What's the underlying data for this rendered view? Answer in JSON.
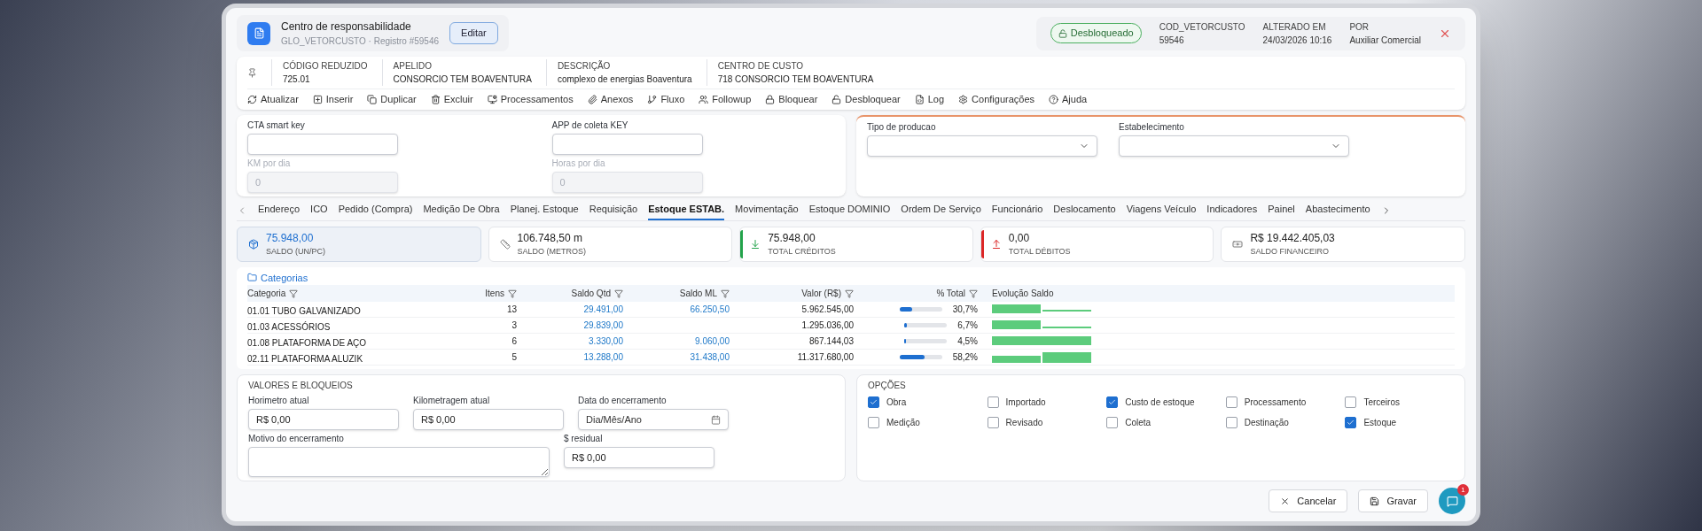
{
  "record": {
    "title": "Centro de responsabilidade",
    "subtitle": "GLO_VETORCUSTO · Registro #59546",
    "edit_button": "Editar"
  },
  "status": {
    "badge": "Desbloqueado",
    "locked": false
  },
  "meta": [
    {
      "label": "COD_VETORCUSTO",
      "value": "59546"
    },
    {
      "label": "ALTERADO EM",
      "value": "24/03/2026 10:16"
    },
    {
      "label": "POR",
      "value": "Auxiliar Comercial"
    }
  ],
  "info": [
    {
      "label": "CÓDIGO REDUZIDO",
      "value": "725.01"
    },
    {
      "label": "APELIDO",
      "value": "CONSORCIO TEM BOAVENTURA"
    },
    {
      "label": "DESCRIÇÃO",
      "value": "complexo de energias Boaventura"
    },
    {
      "label": "CENTRO DE CUSTO",
      "value": "718 CONSORCIO TEM BOAVENTURA"
    }
  ],
  "toolbar": [
    "Atualizar",
    "Inserir",
    "Duplicar",
    "Excluir",
    "Processamentos",
    "Anexos",
    "Fluxo",
    "Followup",
    "Bloquear",
    "Desbloquear",
    "Log",
    "Configurações",
    "Ajuda"
  ],
  "form_left": [
    {
      "kind": "text",
      "label": "CTA smart key",
      "disabled": false
    },
    {
      "kind": "text",
      "label": "APP de coleta KEY",
      "disabled": false
    },
    {
      "kind": "text",
      "label": "KM por dia",
      "value": "0",
      "disabled": true
    },
    {
      "kind": "text",
      "label": "Horas por dia",
      "value": "0",
      "disabled": true
    }
  ],
  "form_right": [
    {
      "kind": "select",
      "label": "Tipo de producao",
      "disabled": false
    },
    {
      "kind": "select",
      "label": "Estabelecimento",
      "disabled": false
    }
  ],
  "tabs": [
    {
      "label": "Endereço",
      "selected": false
    },
    {
      "label": "ICO",
      "selected": false
    },
    {
      "label": "Pedido (Compra)",
      "selected": false
    },
    {
      "label": "Medição De Obra",
      "selected": false
    },
    {
      "label": "Planej. Estoque",
      "selected": false
    },
    {
      "label": "Requisição",
      "selected": false
    },
    {
      "label": "Estoque ESTAB.",
      "selected": true
    },
    {
      "label": "Movimentação",
      "selected": false
    },
    {
      "label": "Estoque DOMINIO",
      "selected": false
    },
    {
      "label": "Ordem De Serviço",
      "selected": false
    },
    {
      "label": "Funcionário",
      "selected": false
    },
    {
      "label": "Deslocamento",
      "selected": false
    },
    {
      "label": "Viagens Veículo",
      "selected": false
    },
    {
      "label": "Indicadores",
      "selected": false
    },
    {
      "label": "Painel",
      "selected": false
    },
    {
      "label": "Abastecimento",
      "selected": false
    }
  ],
  "stats": [
    {
      "value": "75.948,00",
      "label": "SALDO (UN/PC)",
      "selected": true
    },
    {
      "value": "106.748,50 m",
      "label": "SALDO (METROS)",
      "selected": false
    },
    {
      "value": "75.948,00",
      "label": "TOTAL CRÉDITOS",
      "selected": false,
      "color": "#22a34a"
    },
    {
      "value": "0,00",
      "label": "TOTAL DÉBITOS",
      "selected": false,
      "color": "#dc2626"
    },
    {
      "value": "R$ 19.442.405,03",
      "label": "SALDO FINANCEIRO",
      "selected": false
    }
  ],
  "table": {
    "link": "Categorias",
    "columns": [
      {
        "label": "Categoria",
        "filter": true
      },
      {
        "label": "Itens",
        "filter": true
      },
      {
        "label": "Saldo Qtd",
        "filter": true
      },
      {
        "label": "Saldo ML",
        "filter": true
      },
      {
        "label": "Valor (R$)",
        "filter": true
      },
      {
        "label": "% Total",
        "filter": true
      },
      {
        "label": "Evolução Saldo",
        "filter": false
      }
    ],
    "rows": [
      {
        "categoria": "01.01 TUBO GALVANIZADO",
        "itens": "13",
        "saldo_qtd": "29.491,00",
        "saldo_ml": "66.250,50",
        "valor": "5.962.545,00",
        "percent": "30,7%",
        "level": 0.307
      },
      {
        "categoria": "01.03 ACESSÓRIOS",
        "itens": "3",
        "saldo_qtd": "29.839,00",
        "valor": "1.295.036,00",
        "percent": "6,7%",
        "level": 0.067
      },
      {
        "categoria": "01.08 PLATAFORMA DE AÇO",
        "itens": "6",
        "saldo_qtd": "3.330,00",
        "saldo_ml": "9.060,00",
        "valor": "867.144,03",
        "percent": "4,5%",
        "level": 0.045
      },
      {
        "categoria": "02.11 PLATAFORMA ALUZIK",
        "itens": "5",
        "saldo_qtd": "13.288,00",
        "saldo_ml": "31.438,00",
        "valor": "11.317.680,00",
        "percent": "58,2%",
        "level": 0.582
      }
    ]
  },
  "valores": {
    "title": "VALORES E BLOQUEIOS",
    "fields": [
      {
        "kind": "text",
        "label": "Horimetro atual",
        "value": "R$ 0,00",
        "disabled": false
      },
      {
        "kind": "text",
        "label": "Kilometragem atual",
        "value": "R$ 0,00",
        "disabled": false
      },
      {
        "kind": "date",
        "label": "Data do encerramento",
        "placeholder": "Dia/Mês/Ano"
      },
      {
        "kind": "textarea",
        "label": "Motivo do encerramento"
      },
      {
        "kind": "text",
        "label": "$ residual",
        "value": "R$ 0,00",
        "disabled": false
      }
    ]
  },
  "opcoes": {
    "title": "OPÇÕES",
    "items": [
      {
        "label": "Obra",
        "checked": true
      },
      {
        "label": "Importado",
        "checked": false
      },
      {
        "label": "Custo de estoque",
        "checked": true
      },
      {
        "label": "Processamento",
        "checked": false
      },
      {
        "label": "Terceiros",
        "checked": false
      },
      {
        "label": "Medição",
        "checked": false
      },
      {
        "label": "Revisado",
        "checked": false
      },
      {
        "label": "Coleta",
        "checked": false
      },
      {
        "label": "Destinação",
        "checked": false
      },
      {
        "label": "Estoque",
        "checked": true
      }
    ]
  },
  "footer": {
    "cancel": "Cancelar",
    "save": "Gravar"
  },
  "chat": {
    "badge": "1"
  }
}
